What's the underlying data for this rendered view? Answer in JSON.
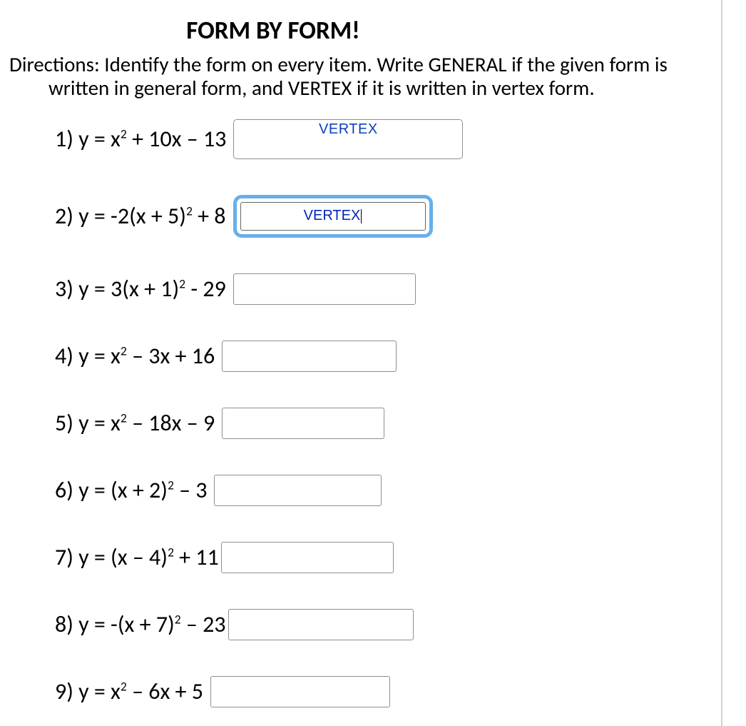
{
  "title": "FORM BY FORM!",
  "directions_line1": "Directions: Identify the form on every item. Write GENERAL if the given form is",
  "directions_line2": "written in general form, and VERTEX if it is written in vertex form.",
  "items": [
    {
      "num": "1)",
      "pre": "y = x",
      "sup": "2",
      "post": " + 10x – 13",
      "answer": "VERTEX",
      "focused": false,
      "placeholder_style": true
    },
    {
      "num": "2)",
      "pre": "y = -2(x + 5)",
      "sup": "2",
      "post": " + 8",
      "answer": "VERTEX",
      "focused": true,
      "placeholder_style": false
    },
    {
      "num": "3)",
      "pre": "y = 3(x + 1)",
      "sup": "2",
      "post": " - 29",
      "answer": "",
      "focused": false,
      "placeholder_style": false
    },
    {
      "num": "4)",
      "pre": "y = x",
      "sup": "2",
      "post": " – 3x + 16",
      "answer": "",
      "focused": false,
      "placeholder_style": false
    },
    {
      "num": "5)",
      "pre": "y = x",
      "sup": "2",
      "post": " – 18x – 9",
      "answer": "",
      "focused": false,
      "placeholder_style": false
    },
    {
      "num": "6)",
      "pre": "y = (x + 2)",
      "sup": "2",
      "post": " – 3",
      "answer": "",
      "focused": false,
      "placeholder_style": false
    },
    {
      "num": "7)",
      "pre": "y = (x – 4)",
      "sup": "2",
      "post": " + 11",
      "answer": "",
      "focused": false,
      "placeholder_style": false
    },
    {
      "num": "8)",
      "pre": "y = -(x + 7)",
      "sup": "2",
      "post": " – 23",
      "answer": "",
      "focused": false,
      "placeholder_style": false
    },
    {
      "num": "9)",
      "pre": "y = x",
      "sup": "2",
      "post": " – 6x + 5",
      "answer": "",
      "focused": false,
      "placeholder_style": false
    }
  ],
  "partial_next_item_prefix": ""
}
